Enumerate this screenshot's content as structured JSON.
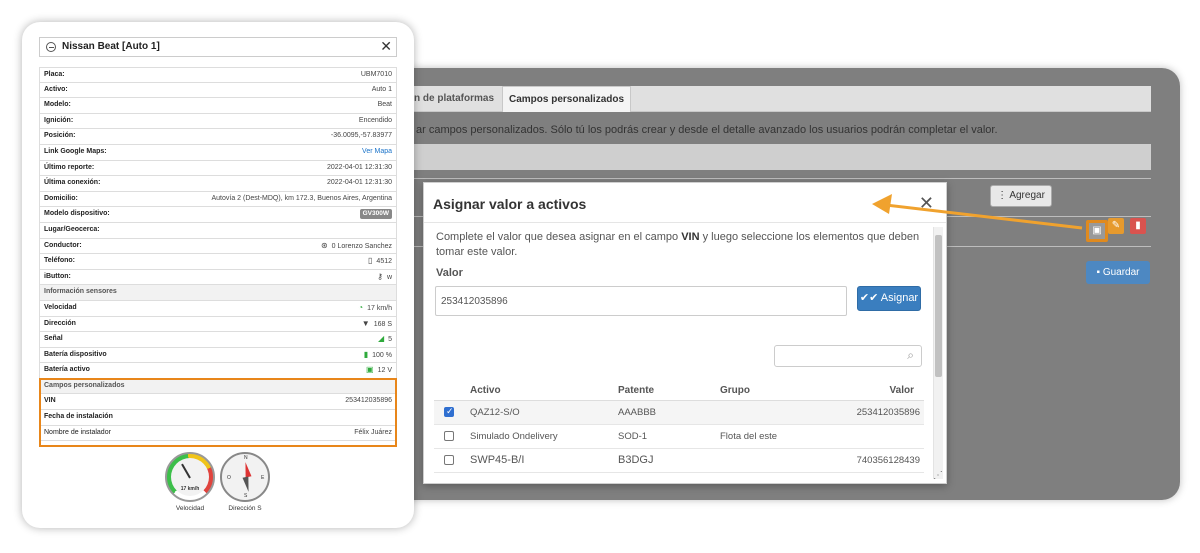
{
  "background_window": {
    "tabs": [
      {
        "label": "n de plataformas"
      },
      {
        "label": "Campos personalizados"
      }
    ],
    "description": "ar campos personalizados. Sólo tú los podrás crear y desde el detalle avanzado los usuarios podrán completar el valor.",
    "add_label": "Agregar",
    "save_label": "Guardar"
  },
  "modal": {
    "title": "Asignar valor a activos",
    "description_pre": "Complete el valor que desea asignar en el campo ",
    "description_bold": "VIN",
    "description_post": " y luego seleccione los elementos que deben tomar este valor.",
    "value_label": "Valor",
    "value_input": "253412035896",
    "assign_label": "Asignar",
    "search_placeholder": "",
    "columns": [
      "Activo",
      "Patente",
      "Grupo",
      "Valor"
    ],
    "rows": [
      {
        "checked": true,
        "activo": "QAZ12-S/O",
        "patente": "AAABBB",
        "grupo": "",
        "valor": "253412035896"
      },
      {
        "checked": false,
        "activo": "Simulado Ondelivery",
        "patente": "SOD-1",
        "grupo": "Flota del este",
        "valor": ""
      },
      {
        "checked": false,
        "activo": "SWP45-B/I",
        "patente": "B3DGJ",
        "grupo": "",
        "valor": "740356128439"
      }
    ]
  },
  "card": {
    "title": "Nissan Beat [Auto 1]",
    "rows": [
      {
        "key": "Placa:",
        "value": "UBM7010"
      },
      {
        "key": "Activo:",
        "value": "Auto 1"
      },
      {
        "key": "Modelo:",
        "value": "Beat"
      },
      {
        "key": "Ignición:",
        "value": "Encendido"
      },
      {
        "key": "Posición:",
        "value": "-36.0095,-57.83977"
      },
      {
        "key": "Link Google Maps:",
        "value": "Ver Mapa"
      },
      {
        "key": "Último reporte:",
        "value": "2022-04-01 12:31:30"
      },
      {
        "key": "Última conexión:",
        "value": "2022-04-01 12:31:30"
      },
      {
        "key": "Domicilio:",
        "value": "Autovía 2 (Dest-MDQ), km 172.3, Buenos Aires, Argentina"
      },
      {
        "key": "Modelo dispositivo:",
        "value": "GV300W"
      },
      {
        "key": "Lugar/Geocerca:",
        "value": ""
      },
      {
        "key": "Conductor:",
        "value": "0 Lorenzo Sanchez"
      },
      {
        "key": "Teléfono:",
        "value": "4512"
      },
      {
        "key": "iButton:",
        "value": "w"
      }
    ],
    "sensors_header": "Información sensores",
    "sensors": [
      {
        "key": "Velocidad",
        "value": "17 km/h"
      },
      {
        "key": "Dirección",
        "value": "168 S"
      },
      {
        "key": "Señal",
        "value": "5"
      },
      {
        "key": "Batería dispositivo",
        "value": "100 %"
      },
      {
        "key": "Batería activo",
        "value": "12 V"
      }
    ],
    "custom_header": "Campos personalizados",
    "custom": [
      {
        "key": "VIN",
        "value": "253412035896"
      },
      {
        "key": "Fecha de instalación",
        "value": ""
      },
      {
        "key": "Nombre de instalador",
        "value": "Félix Juárez"
      }
    ],
    "gauge_speed_value": "17 km/h",
    "gauge_speed_label": "Velocidad",
    "gauge_dir_label": "Dirección S",
    "compass_points": {
      "n": "N",
      "e": "E",
      "s": "S",
      "o": "O"
    }
  },
  "colors": {
    "highlight": "#e8861a",
    "primary": "#3a7ebf",
    "link": "#1a73c9"
  }
}
